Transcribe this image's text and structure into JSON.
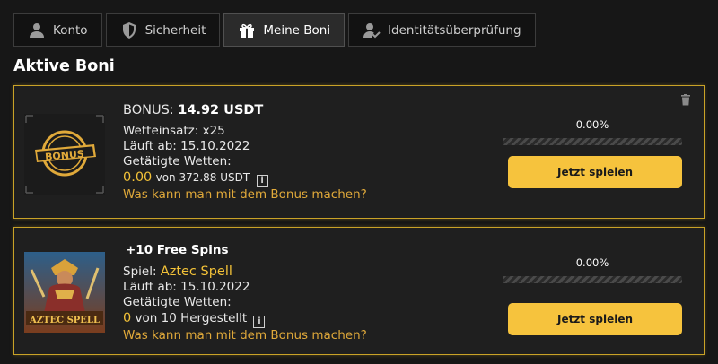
{
  "tabs": [
    {
      "label": "Konto",
      "icon": "user-icon",
      "active": false
    },
    {
      "label": "Sicherheit",
      "icon": "shield-icon",
      "active": false
    },
    {
      "label": "Meine Boni",
      "icon": "gift-icon",
      "active": true
    },
    {
      "label": "Identitätsüberprüfung",
      "icon": "user-check-icon",
      "active": false
    }
  ],
  "section_title": "Aktive Boni",
  "bonuses": [
    {
      "title_prefix": "BONUS:",
      "title_value": "14.92 USDT",
      "wager_label": "Wetteinsatz:",
      "wager_value": "x25",
      "expires_label": "Läuft ab:",
      "expires_value": "15.10.2022",
      "bets_label": "Getätigte Wetten:",
      "bets_done": "0.00",
      "bets_of": "von 372.88 USDT",
      "link": "Was kann man mit dem Bonus machen?",
      "progress_text": "0.00%",
      "progress": 0.0,
      "button": "Jetzt spielen",
      "image_text": "BONUS"
    },
    {
      "title": "+10 Free Spins",
      "game_label": "Spiel:",
      "game_value": "Aztec Spell",
      "expires_label": "Läuft ab:",
      "expires_value": "15.10.2022",
      "bets_label": "Getätigte Wetten:",
      "bets_done": "0",
      "bets_of": "von 10 Hergestellt",
      "link": "Was kann man mit dem Bonus machen?",
      "progress_text": "0.00%",
      "progress": 0.0,
      "button": "Jetzt spielen",
      "image_text": "AZTEC SPELL"
    }
  ],
  "colors": {
    "accent": "#f6c33d",
    "card_border": "#c9a227",
    "link": "#e0a93a",
    "background": "#171717"
  }
}
